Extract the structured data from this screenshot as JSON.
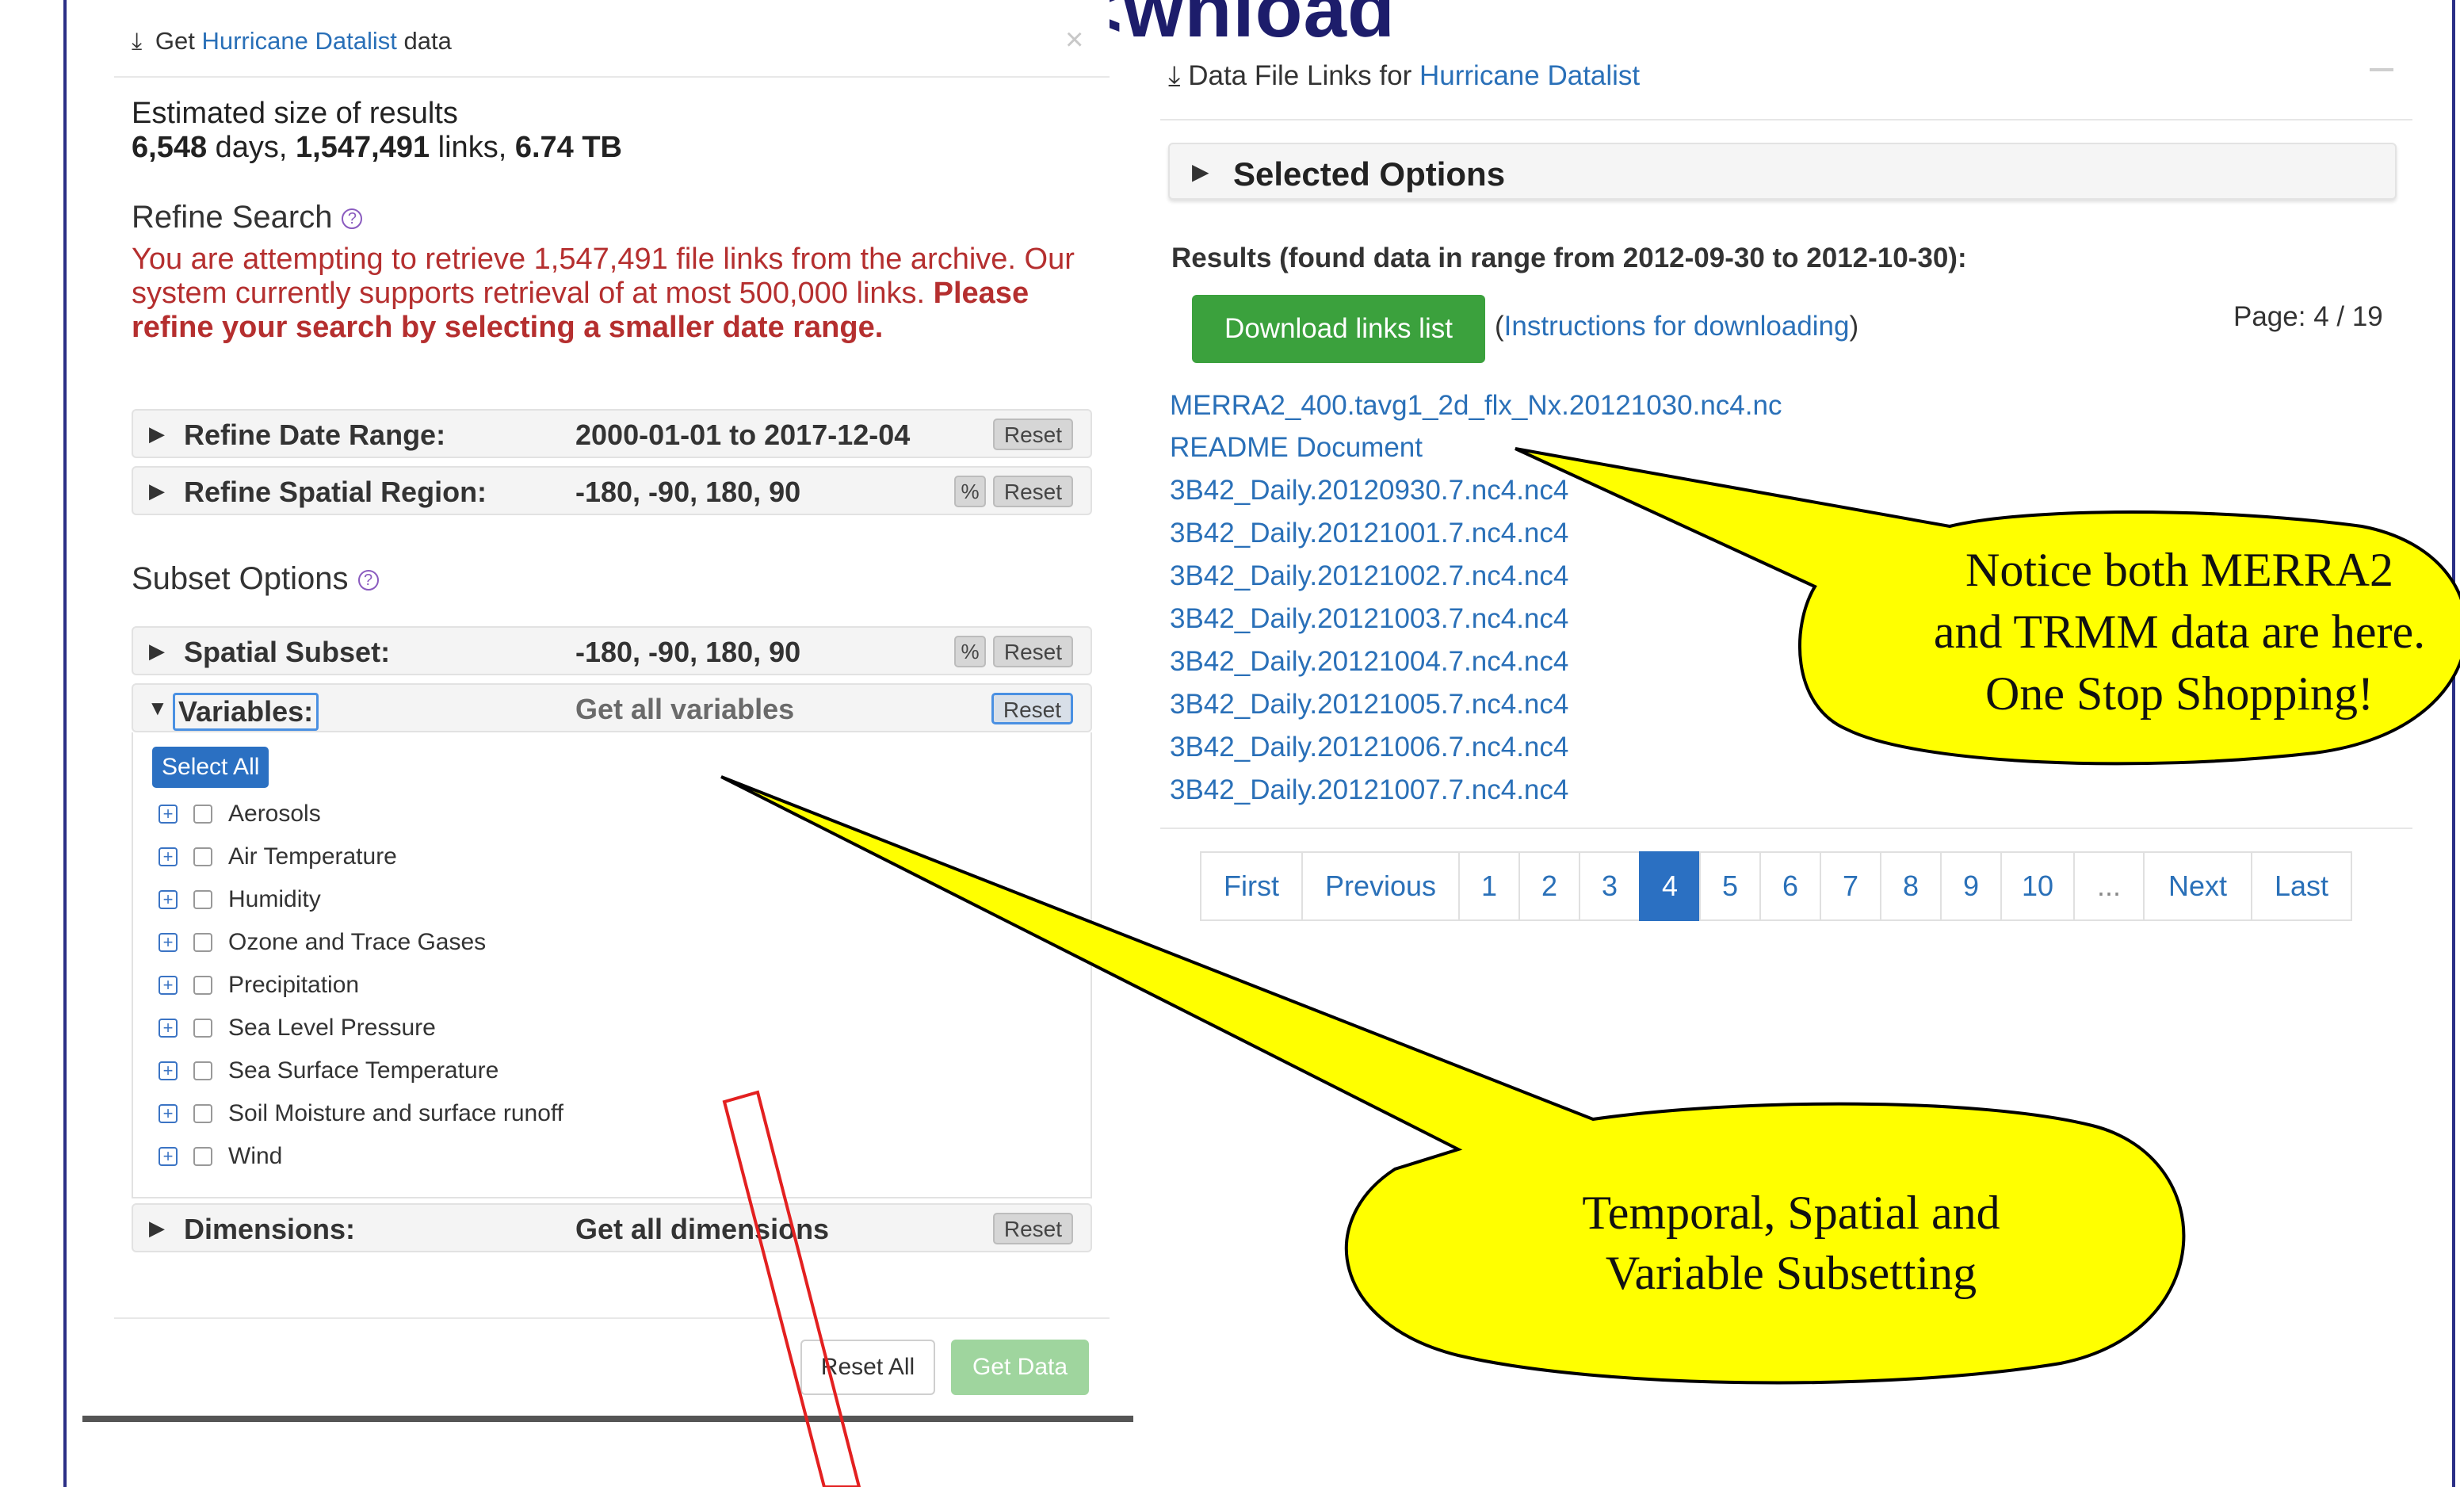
{
  "slide": {
    "title": "Fi<wnload"
  },
  "left_panel": {
    "header_prefix": "Get",
    "header_brand": "Hurricane Datalist",
    "header_suffix": "data",
    "close": "×",
    "estimate_label": "Estimated size of results",
    "estimate_days": "6,548",
    "estimate_days_unit": "days,",
    "estimate_links": "1,547,491",
    "estimate_links_unit": "links,",
    "estimate_size": "6.74 TB",
    "refine_title": "Refine Search",
    "warning_normal": "You are attempting to retrieve 1,547,491 file links from the archive. Our system currently supports retrieval of at most 500,000 links. ",
    "warning_bold": "Please refine your search by selecting a smaller date range.",
    "date_range_label": "Refine Date Range:",
    "date_range_value": "2000-01-01 to 2017-12-04",
    "spatial_region_label": "Refine Spatial Region:",
    "spatial_region_value": "-180, -90, 180, 90",
    "subset_title": "Subset Options",
    "spatial_subset_label": "Spatial Subset:",
    "spatial_subset_value": "-180, -90, 180, 90",
    "variables_label": "Variables:",
    "variables_value": "Get all variables",
    "select_all": "Select All",
    "variables": [
      "Aerosols",
      "Air Temperature",
      "Humidity",
      "Ozone and Trace Gases",
      "Precipitation",
      "Sea Level Pressure",
      "Sea Surface Temperature",
      "Soil Moisture and surface runoff",
      "Wind"
    ],
    "dimensions_label": "Dimensions:",
    "dimensions_value": "Get all dimensions",
    "reset": "Reset",
    "reset_all": "Reset All",
    "get_data": "Get Data"
  },
  "right_panel": {
    "header_prefix": "Data File Links for",
    "header_brand": "Hurricane Datalist",
    "selected_options": "Selected Options",
    "results": "Results (found data in range from 2012-09-30 to 2012-10-30):",
    "download_button": "Download links list",
    "instructions_open": "(",
    "instructions_link": "Instructions for downloading",
    "instructions_close": ")",
    "page_info": "Page: 4 / 19",
    "files": [
      "MERRA2_400.tavg1_2d_flx_Nx.20121030.nc4.nc",
      "README Document",
      "3B42_Daily.20120930.7.nc4.nc4",
      "3B42_Daily.20121001.7.nc4.nc4",
      "3B42_Daily.20121002.7.nc4.nc4",
      "3B42_Daily.20121003.7.nc4.nc4",
      "3B42_Daily.20121004.7.nc4.nc4",
      "3B42_Daily.20121005.7.nc4.nc4",
      "3B42_Daily.20121006.7.nc4.nc4",
      "3B42_Daily.20121007.7.nc4.nc4"
    ],
    "pager": [
      "First",
      "Previous",
      "1",
      "2",
      "3",
      "4",
      "5",
      "6",
      "7",
      "8",
      "9",
      "10",
      "...",
      "Next",
      "Last"
    ],
    "pager_active": "4"
  },
  "callouts": {
    "top_line1": "Notice both MERRA2",
    "top_line2": "and TRMM data are here.",
    "top_line3": "One Stop Shopping!",
    "bottom_line1": "Temporal, Spatial and",
    "bottom_line2": "Variable Subsetting"
  },
  "colors": {
    "brand_link": "#2a70b8",
    "callout_fill": "#ffff00",
    "warning": "#b52f2f",
    "frame": "#2b2f86",
    "download": "#3ba13d"
  }
}
